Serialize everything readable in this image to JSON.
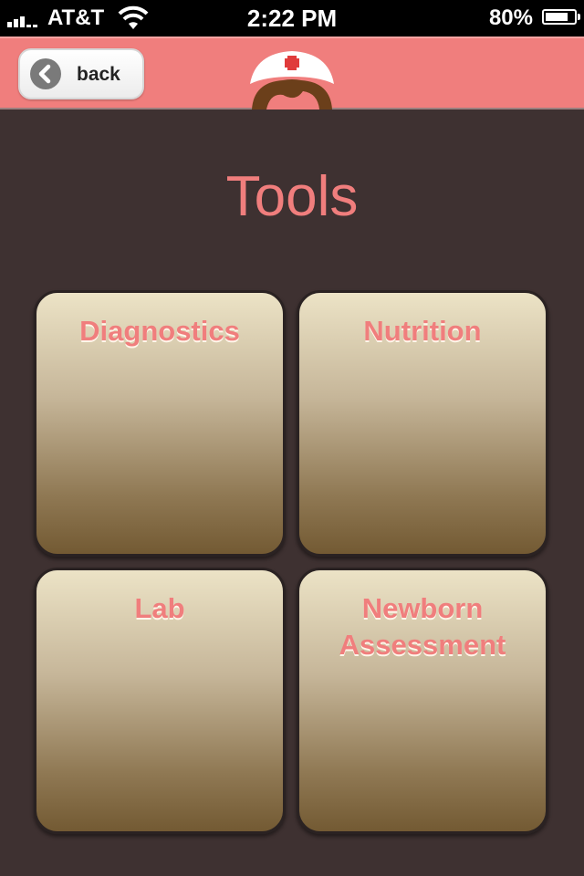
{
  "status_bar": {
    "carrier": "AT&T",
    "time": "2:22 PM",
    "battery_percent": "80%",
    "battery_level": 0.8,
    "signal_bars": 3
  },
  "nav_bar": {
    "back_label": "back",
    "accent_color": "#f07e7d",
    "logo_icon": "nurse-cap-logo"
  },
  "page": {
    "title": "Tools"
  },
  "tiles": [
    {
      "label": "Diagnostics"
    },
    {
      "label": "Nutrition"
    },
    {
      "label": "Lab"
    },
    {
      "label": "Newborn Assessment"
    }
  ]
}
